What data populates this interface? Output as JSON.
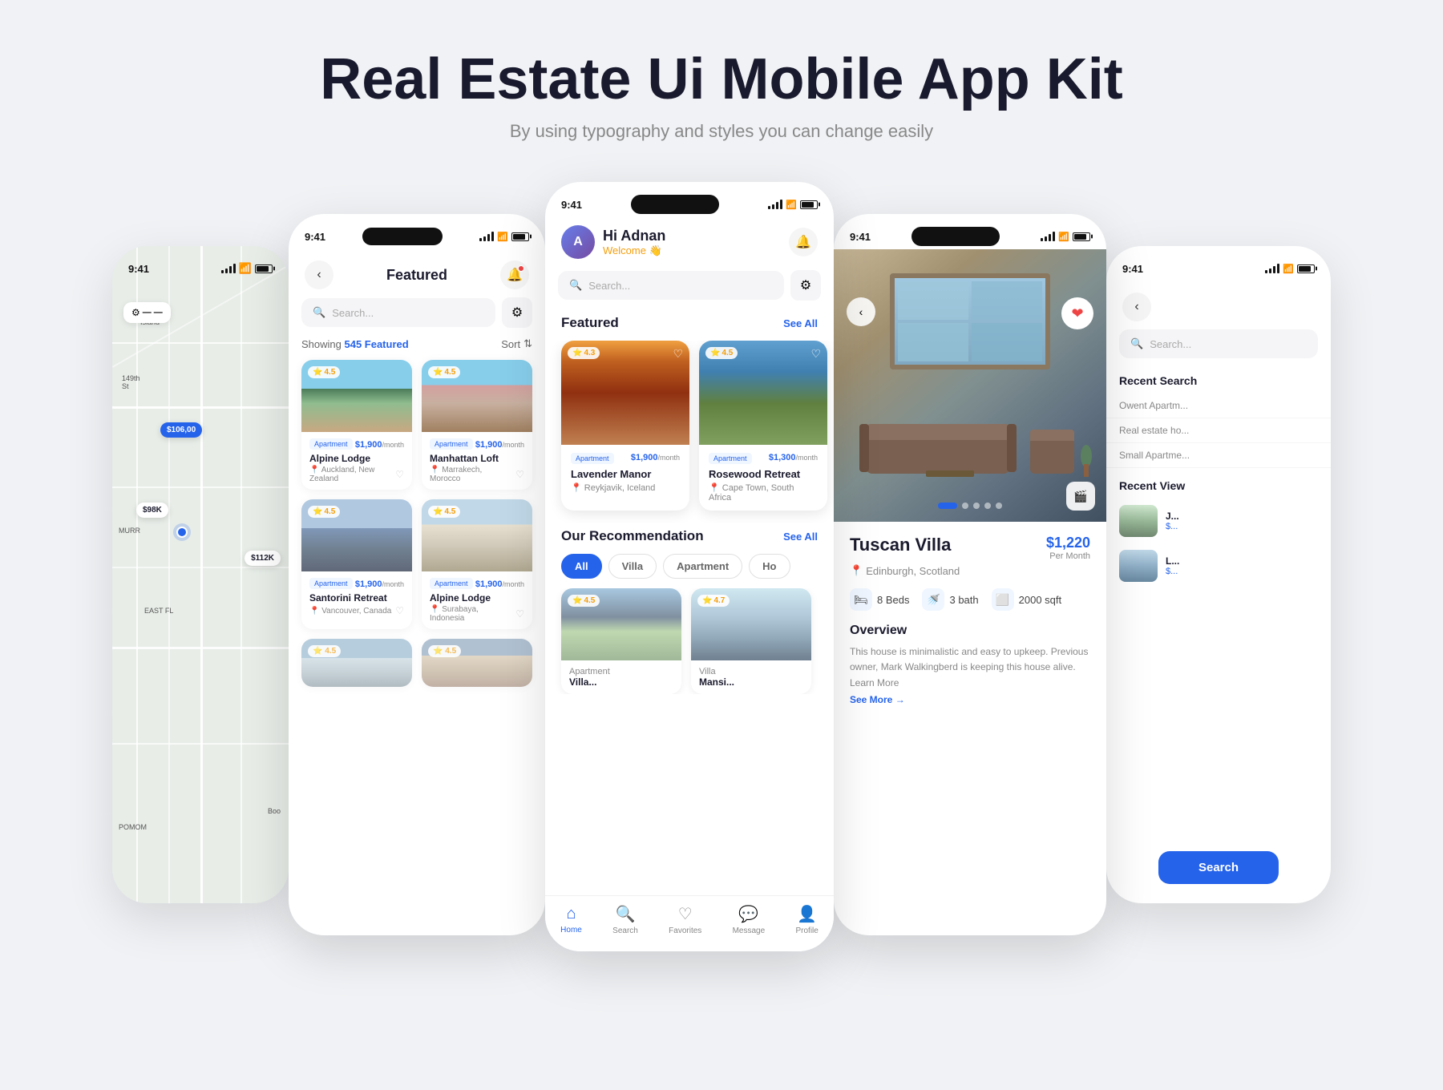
{
  "page": {
    "title": "Real Estate Ui Mobile App Kit",
    "subtitle": "By using typography and styles you can change easily"
  },
  "phone_map": {
    "status_time": "9:41",
    "prices": [
      "$106,00",
      "$98,000",
      "$112,000"
    ],
    "filter_icon": "⚙"
  },
  "phone_featured": {
    "status_time": "9:41",
    "back_label": "‹",
    "title": "Featured",
    "showing_prefix": "Showing ",
    "showing_count": "545 Featured",
    "sort_label": "Sort",
    "search_placeholder": "Search...",
    "properties": [
      {
        "name": "Alpine Lodge",
        "location": "Auckland, New Zealand",
        "type": "Apartment",
        "price": "$1,900",
        "price_unit": "/month",
        "rating": "4.5"
      },
      {
        "name": "Manhattan Loft",
        "location": "Marrakech, Morocco",
        "type": "Apartment",
        "price": "$1,900",
        "price_unit": "/month",
        "rating": "4.5"
      },
      {
        "name": "Santorini Retreat",
        "location": "Vancouver, Canada",
        "type": "Apartment",
        "price": "$1,900",
        "price_unit": "/month",
        "rating": "4.5"
      },
      {
        "name": "Alpine Lodge",
        "location": "Surabaya, Indonesia",
        "type": "Apartment",
        "price": "$1,900",
        "price_unit": "/month",
        "rating": "4.5"
      }
    ]
  },
  "phone_home": {
    "status_time": "9:41",
    "greeting": "Hi Adnan",
    "welcome": "Welcome 👋",
    "notif_icon": "🔔",
    "search_placeholder": "Search...",
    "featured_title": "Featured",
    "see_all": "See All",
    "recommendation_title": "Our Recommendation",
    "filter_tabs": [
      "All",
      "Villa",
      "Apartment",
      "Ho"
    ],
    "featured_properties": [
      {
        "name": "Lavender Manor",
        "location": "Reykjavik, Iceland",
        "type": "Apartment",
        "price": "$1,900",
        "price_unit": "/month",
        "rating": "4.3"
      },
      {
        "name": "Rosewood Retreat",
        "location": "Cape Town, South Africa",
        "type": "Apartment",
        "price": "$1,300",
        "price_unit": "/month",
        "rating": "4.5"
      }
    ],
    "rec_properties": [
      {
        "rating": "4.5"
      },
      {
        "rating": "4.7"
      }
    ],
    "nav_items": [
      {
        "label": "Home",
        "icon": "⌂",
        "active": true
      },
      {
        "label": "Search",
        "icon": "🔍",
        "active": false
      },
      {
        "label": "Favorites",
        "icon": "♡",
        "active": false
      },
      {
        "label": "Message",
        "icon": "💬",
        "active": false
      },
      {
        "label": "Profile",
        "icon": "👤",
        "active": false
      }
    ]
  },
  "phone_detail": {
    "status_time": "9:41",
    "property_name": "Tuscan Villa",
    "property_location": "Edinburgh, Scotland",
    "price": "$1,220",
    "per_month": "Per Month",
    "beds": "8 Beds",
    "bath": "3 bath",
    "sqft": "2000 sqft",
    "overview_title": "Overview",
    "overview_text": "This house is minimalistic and easy to upkeep. Previous owner, Mark Walkingberd is keeping this house alive. Learn More",
    "see_more": "See More →",
    "dots": 5,
    "active_dot": 1
  },
  "phone_search": {
    "status_time": "9:41",
    "back_label": "‹",
    "search_placeholder": "Search...",
    "recent_search_title": "Recent Search",
    "recent_searches": [
      "Owent Apartm...",
      "Real estate ho...",
      "Small Apartme..."
    ],
    "recent_view_title": "Recent View",
    "recent_views": [
      {
        "name": "J...",
        "price": "$..."
      },
      {
        "name": "L...",
        "price": "$..."
      }
    ],
    "search_btn": "Search"
  }
}
